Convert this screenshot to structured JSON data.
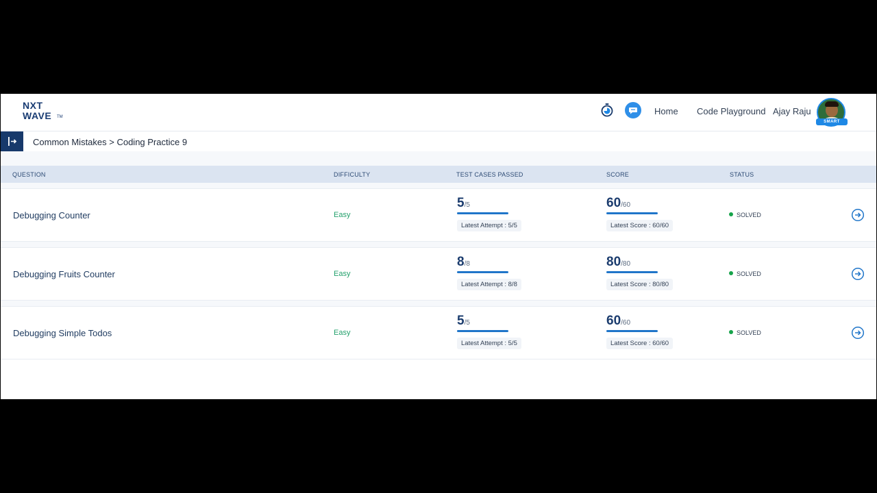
{
  "header": {
    "logo_line1": "NXT",
    "logo_line2": "WAVE",
    "logo_tm": "TM",
    "nav": {
      "home": "Home",
      "code_playground": "Code Playground"
    },
    "user_name": "Ajay Raju",
    "avatar_badge": "SMART"
  },
  "breadcrumb": "Common Mistakes > Coding Practice 9",
  "table": {
    "columns": {
      "question": "QUESTION",
      "difficulty": "DIFFICULTY",
      "test_cases": "TEST CASES PASSED",
      "score": "SCORE",
      "status": "STATUS"
    },
    "rows": [
      {
        "title": "Debugging Counter",
        "difficulty": "Easy",
        "tests_passed": "5",
        "tests_total": "/5",
        "latest_attempt": "Latest Attempt : 5/5",
        "score": "60",
        "score_total": "/60",
        "latest_score": "Latest Score : 60/60",
        "status": "SOLVED"
      },
      {
        "title": "Debugging Fruits Counter",
        "difficulty": "Easy",
        "tests_passed": "8",
        "tests_total": "/8",
        "latest_attempt": "Latest Attempt : 8/8",
        "score": "80",
        "score_total": "/80",
        "latest_score": "Latest Score : 80/80",
        "status": "SOLVED"
      },
      {
        "title": "Debugging Simple Todos",
        "difficulty": "Easy",
        "tests_passed": "5",
        "tests_total": "/5",
        "latest_attempt": "Latest Attempt : 5/5",
        "score": "60",
        "score_total": "/60",
        "latest_score": "Latest Score : 60/60",
        "status": "SOLVED"
      }
    ]
  },
  "colors": {
    "brand_navy": "#17396b",
    "accent_blue": "#1f75c9",
    "easy_green": "#22a06b",
    "solved_dot": "#16a34a"
  },
  "icons": {
    "timer": "stopwatch-icon",
    "chat": "chat-bubble-icon",
    "sidebar": "sidebar-expand-icon",
    "row_action": "arrow-right-circle-icon"
  }
}
